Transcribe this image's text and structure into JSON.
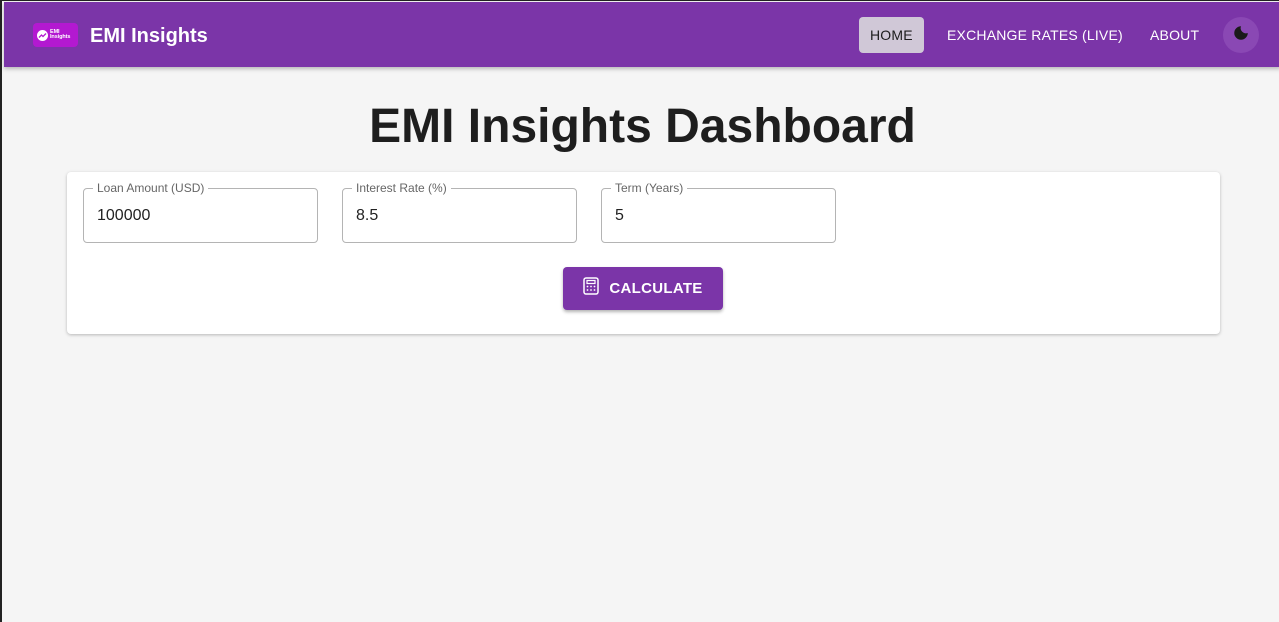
{
  "header": {
    "logo_text_line1": "EMI",
    "logo_text_line2": "Insights",
    "brand": "EMI Insights",
    "nav": [
      {
        "label": "HOME",
        "active": true
      },
      {
        "label": "EXCHANGE RATES (LIVE)",
        "active": false
      },
      {
        "label": "ABOUT",
        "active": false
      }
    ],
    "theme_icon": "moon-icon"
  },
  "main": {
    "title": "EMI Insights Dashboard",
    "form": {
      "loan_amount": {
        "label": "Loan Amount (USD)",
        "value": "100000"
      },
      "interest_rate": {
        "label": "Interest Rate (%)",
        "value": "8.5"
      },
      "term": {
        "label": "Term (Years)",
        "value": "5"
      }
    },
    "calculate": {
      "label": "CALCULATE",
      "icon": "calculator-icon"
    }
  },
  "colors": {
    "primary": "#7b35a8",
    "logo_bg": "#b319d1",
    "background": "#f5f5f5"
  }
}
